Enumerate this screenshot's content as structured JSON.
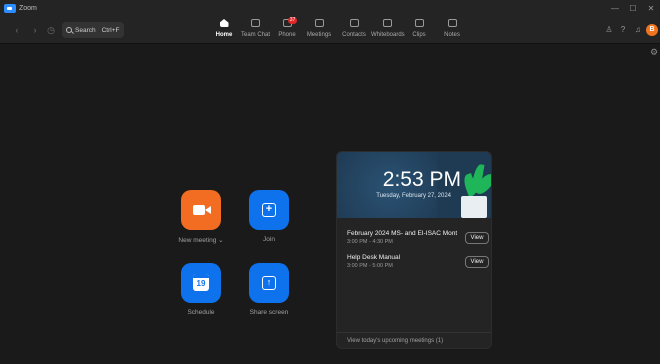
{
  "app": {
    "title": "Zoom"
  },
  "window": {
    "minimize": "—",
    "maximize": "☐",
    "close": "✕"
  },
  "search": {
    "label": "Search",
    "shortcut": "Ctrl+F"
  },
  "tabs": [
    {
      "label": "Home",
      "icon": "home-icon"
    },
    {
      "label": "Team Chat",
      "icon": "chat-icon"
    },
    {
      "label": "Phone",
      "icon": "phone-icon",
      "badge": "37"
    },
    {
      "label": "Meetings",
      "icon": "video-icon"
    },
    {
      "label": "Contacts",
      "icon": "contacts-icon"
    },
    {
      "label": "Whiteboards",
      "icon": "whiteboard-icon"
    },
    {
      "label": "Clips",
      "icon": "clips-icon"
    },
    {
      "label": "Notes",
      "icon": "notes-icon"
    }
  ],
  "user": {
    "initial": "B"
  },
  "actions": {
    "new_meeting": "New meeting",
    "join": "Join",
    "schedule": "Schedule",
    "schedule_day": "19",
    "share_screen": "Share screen"
  },
  "card": {
    "time": "2:53 PM",
    "date": "Tuesday, February 27, 2024",
    "meetings": [
      {
        "title": "February 2024 MS- and EI-ISAC Month...",
        "time": "3:00 PM - 4:30 PM",
        "action": "View"
      },
      {
        "title": "Help Desk Manual",
        "time": "3:00 PM - 5:00 PM",
        "action": "View"
      }
    ],
    "footer": "View today's upcoming meetings (1)"
  },
  "colors": {
    "accent": "#0e72ed",
    "new_meeting": "#f26d21",
    "badge": "#e02828",
    "avatar": "#f0741f"
  }
}
